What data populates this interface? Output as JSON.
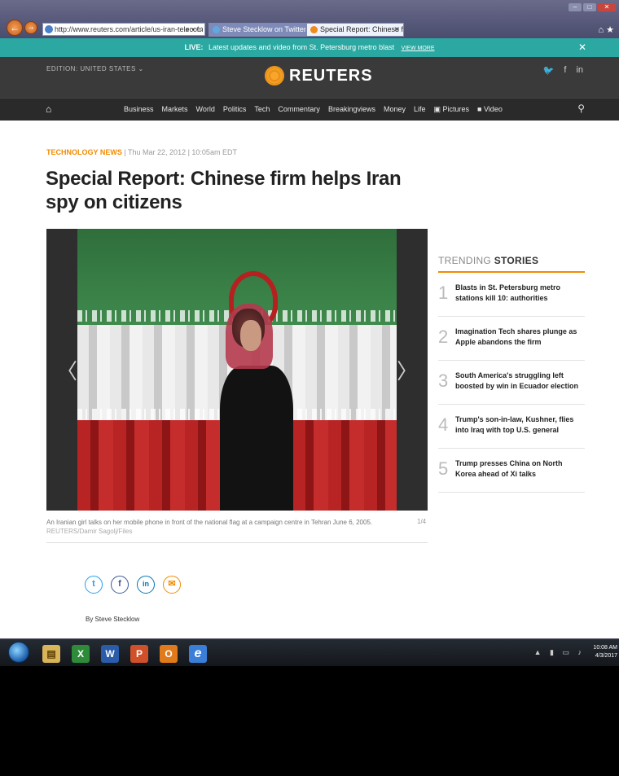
{
  "browser": {
    "url": "http://www.reuters.com/article/us-iran-telecom",
    "tabs": [
      {
        "label": "Steve Stecklow on Twitter: \"A..."
      },
      {
        "label": "Special Report: Chinese fir..."
      }
    ]
  },
  "live_banner": {
    "tag": "LIVE:",
    "text": "Latest updates and video from St. Petersburg metro blast",
    "more": "VIEW MORE"
  },
  "masthead": {
    "edition": "EDITION: UNITED STATES ⌄",
    "logo": "REUTERS"
  },
  "nav": {
    "items": [
      "Business",
      "Markets",
      "World",
      "Politics",
      "Tech",
      "Commentary",
      "Breakingviews",
      "Money",
      "Life",
      "Pictures",
      "Video"
    ]
  },
  "article": {
    "section": "TECHNOLOGY NEWS",
    "dateline": "| Thu Mar 22, 2012 | 10:05am EDT",
    "headline": "Special Report: Chinese firm helps Iran spy on citizens",
    "caption": "An Iranian girl talks on her mobile phone in front of the national flag at a campaign centre in Tehran June 6, 2005.",
    "credit": "REUTERS/Damir Sagolj/Files",
    "counter": "1/4",
    "byline": "By Steve Stecklow"
  },
  "trending": {
    "title_light": "TRENDING ",
    "title_bold": "STORIES",
    "items": [
      {
        "num": "1",
        "text": "Blasts in St. Petersburg metro stations kill 10: authorities"
      },
      {
        "num": "2",
        "text": "Imagination Tech shares plunge as Apple abandons the firm"
      },
      {
        "num": "3",
        "text": "South America's struggling left boosted by win in Ecuador election"
      },
      {
        "num": "4",
        "text": "Trump's son-in-law, Kushner, flies into Iraq with top U.S. general"
      },
      {
        "num": "5",
        "text": "Trump presses China on North Korea ahead of Xi talks"
      }
    ]
  },
  "taskbar": {
    "time": "10:08 AM",
    "date": "4/3/2017"
  },
  "colors": {
    "live_bg": "#2aa8a1",
    "accent": "#f28b00",
    "masthead_bg": "#3a3a3a"
  }
}
